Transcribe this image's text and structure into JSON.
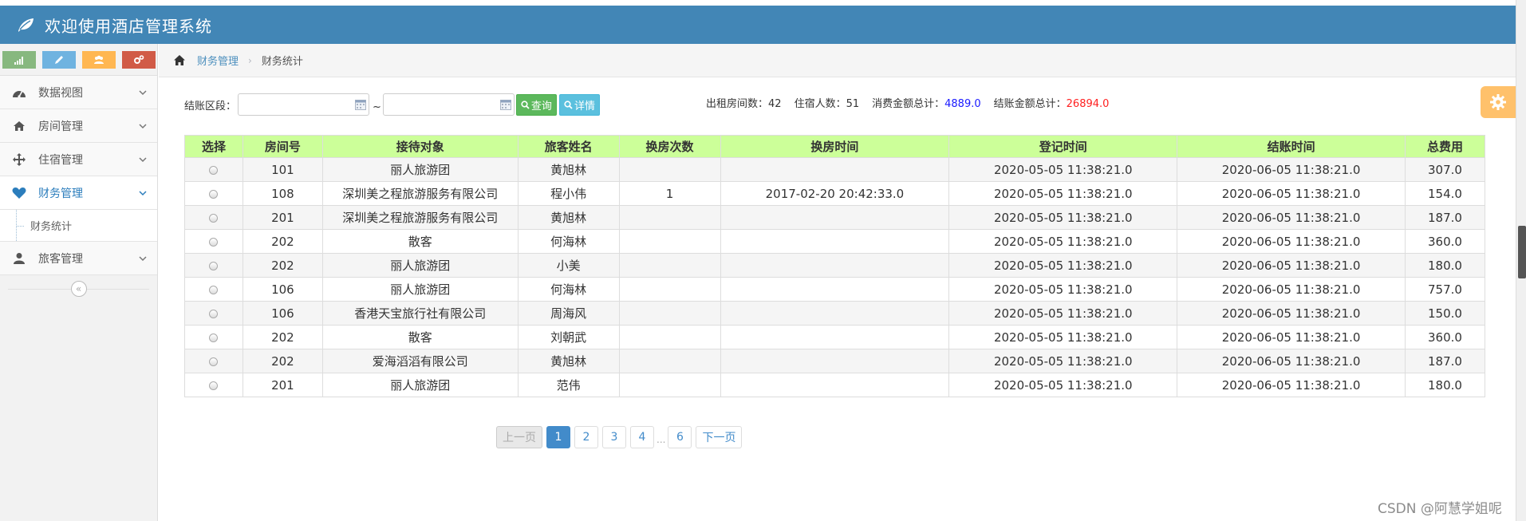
{
  "header": {
    "title": "欢迎使用酒店管理系统",
    "logo_icon": "leaf-icon"
  },
  "sidebar": {
    "shortcuts": [
      {
        "icon": "signal-icon",
        "color": "#87b87f"
      },
      {
        "icon": "pencil-icon",
        "color": "#6fb3e0"
      },
      {
        "icon": "users-icon",
        "color": "#ffb752"
      },
      {
        "icon": "cogs-icon",
        "color": "#d15b47"
      }
    ],
    "items": [
      {
        "label": "数据视图",
        "icon": "dashboard-icon"
      },
      {
        "label": "房间管理",
        "icon": "home-icon"
      },
      {
        "label": "住宿管理",
        "icon": "move-icon"
      },
      {
        "label": "财务管理",
        "icon": "heart-icon",
        "active": true
      },
      {
        "label": "旅客管理",
        "icon": "user-icon"
      }
    ],
    "sub_item": "财务统计"
  },
  "breadcrumb": {
    "parent": "财务管理",
    "current": "财务统计"
  },
  "filter": {
    "label": "结账区段：",
    "tilde": "~",
    "query_label": "查询",
    "detail_label": "详情"
  },
  "stats": {
    "rooms_label": "出租房间数：",
    "rooms_value": "42",
    "guests_label": "住宿人数：",
    "guests_value": "51",
    "consume_label": "消费金额总计：",
    "consume_value": "4889.0",
    "checkout_label": "结账金额总计：",
    "checkout_value": "26894.0"
  },
  "table": {
    "headers": [
      "选择",
      "房间号",
      "接待对象",
      "旅客姓名",
      "换房次数",
      "换房时间",
      "登记时间",
      "结账时间",
      "总费用"
    ],
    "rows": [
      [
        "101",
        "丽人旅游团",
        "黄旭林",
        "",
        "",
        "2020-05-05 11:38:21.0",
        "2020-06-05 11:38:21.0",
        "307.0"
      ],
      [
        "108",
        "深圳美之程旅游服务有限公司",
        "程小伟",
        "1",
        "2017-02-20 20:42:33.0",
        "2020-05-05 11:38:21.0",
        "2020-06-05 11:38:21.0",
        "154.0"
      ],
      [
        "201",
        "深圳美之程旅游服务有限公司",
        "黄旭林",
        "",
        "",
        "2020-05-05 11:38:21.0",
        "2020-06-05 11:38:21.0",
        "187.0"
      ],
      [
        "202",
        "散客",
        "何海林",
        "",
        "",
        "2020-05-05 11:38:21.0",
        "2020-06-05 11:38:21.0",
        "360.0"
      ],
      [
        "202",
        "丽人旅游团",
        "小美",
        "",
        "",
        "2020-05-05 11:38:21.0",
        "2020-06-05 11:38:21.0",
        "180.0"
      ],
      [
        "106",
        "丽人旅游团",
        "何海林",
        "",
        "",
        "2020-05-05 11:38:21.0",
        "2020-06-05 11:38:21.0",
        "757.0"
      ],
      [
        "106",
        "香港天宝旅行社有限公司",
        "周海风",
        "",
        "",
        "2020-05-05 11:38:21.0",
        "2020-06-05 11:38:21.0",
        "150.0"
      ],
      [
        "202",
        "散客",
        "刘朝武",
        "",
        "",
        "2020-05-05 11:38:21.0",
        "2020-06-05 11:38:21.0",
        "360.0"
      ],
      [
        "202",
        "爱海滔滔有限公司",
        "黄旭林",
        "",
        "",
        "2020-05-05 11:38:21.0",
        "2020-06-05 11:38:21.0",
        "187.0"
      ],
      [
        "201",
        "丽人旅游团",
        "范伟",
        "",
        "",
        "2020-05-05 11:38:21.0",
        "2020-06-05 11:38:21.0",
        "180.0"
      ]
    ]
  },
  "pagination": {
    "prev": "上一页",
    "pages": [
      "1",
      "2",
      "3",
      "4"
    ],
    "ellipsis": "...",
    "last": "6",
    "next": "下一页",
    "current": "1"
  },
  "watermark": "CSDN @阿慧学姐呢",
  "colors": {
    "header_bg": "#4286b6",
    "table_header_bg": "#ccff99",
    "accent": "#428bca"
  }
}
